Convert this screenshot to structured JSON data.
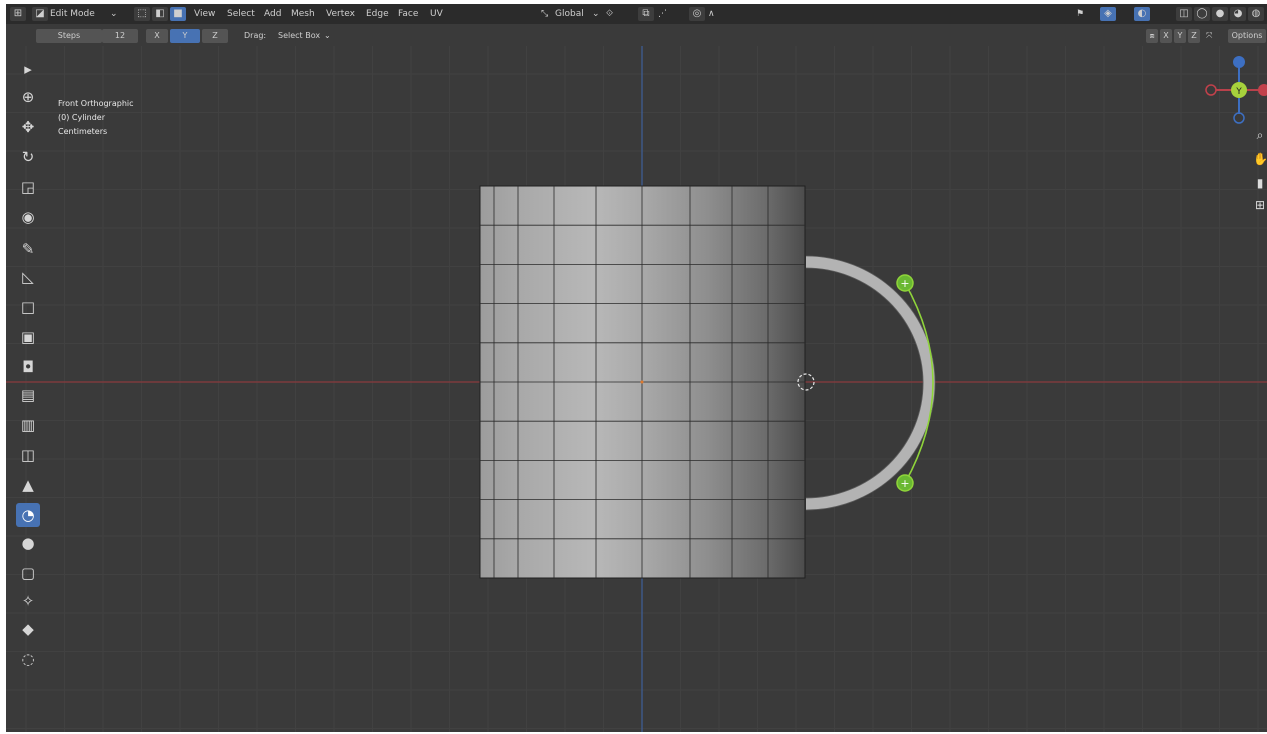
{
  "header": {
    "mode": "Edit Mode",
    "menus": [
      "View",
      "Select",
      "Add",
      "Mesh",
      "Vertex",
      "Edge",
      "Face",
      "UV"
    ],
    "transform_orientation": "Global"
  },
  "tool_settings": {
    "steps_label": "Steps",
    "steps_value": "12",
    "axes": [
      "X",
      "Y",
      "Z"
    ],
    "active_axis": "Y",
    "drag_label": "Drag:",
    "drag_value": "Select Box",
    "right_axes": [
      "X",
      "Y",
      "Z"
    ],
    "options_label": "Options"
  },
  "viewport": {
    "view_name": "Front Orthographic",
    "object": "(0) Cylinder",
    "units": "Centimeters"
  },
  "toolbar": {
    "tools": [
      {
        "name": "select-box-icon",
        "glyph": "▸",
        "active": false
      },
      {
        "name": "cursor-icon",
        "glyph": "⊕",
        "active": false
      },
      {
        "name": "move-icon",
        "glyph": "✥",
        "active": false
      },
      {
        "name": "rotate-icon",
        "glyph": "↻",
        "active": false
      },
      {
        "name": "scale-icon",
        "glyph": "◲",
        "active": false
      },
      {
        "name": "transform-icon",
        "glyph": "◉",
        "active": false
      },
      {
        "name": "annotate-icon",
        "glyph": "✎",
        "active": false
      },
      {
        "name": "measure-icon",
        "glyph": "◺",
        "active": false
      },
      {
        "name": "add-cube-icon",
        "glyph": "□",
        "active": false
      },
      {
        "name": "extrude-icon",
        "glyph": "▣",
        "active": false
      },
      {
        "name": "inset-icon",
        "glyph": "◘",
        "active": false
      },
      {
        "name": "bevel-icon",
        "glyph": "▤",
        "active": false
      },
      {
        "name": "loop-cut-icon",
        "glyph": "▥",
        "active": false
      },
      {
        "name": "knife-icon",
        "glyph": "◫",
        "active": false
      },
      {
        "name": "poly-build-icon",
        "glyph": "▲",
        "active": false
      },
      {
        "name": "spin-icon",
        "glyph": "◔",
        "active": true
      },
      {
        "name": "smooth-icon",
        "glyph": "●",
        "active": false
      },
      {
        "name": "edge-slide-icon",
        "glyph": "▢",
        "active": false
      },
      {
        "name": "shrink-fatten-icon",
        "glyph": "✧",
        "active": false
      },
      {
        "name": "shear-icon",
        "glyph": "◆",
        "active": false
      },
      {
        "name": "rip-region-icon",
        "glyph": "◌",
        "active": false
      }
    ]
  },
  "colors": {
    "background": "#3a3a3a",
    "grid_minor": "#414141",
    "grid_major": "#4a4a4a",
    "x_axis": "#8a3a3e",
    "z_axis": "#3d5f99",
    "accent": "#4772b3",
    "gizmo_green": "#7fc13e",
    "gizmo_handle": "#6ab832"
  },
  "gizmo": {
    "x": "X",
    "y": "Y",
    "z": "Z"
  }
}
